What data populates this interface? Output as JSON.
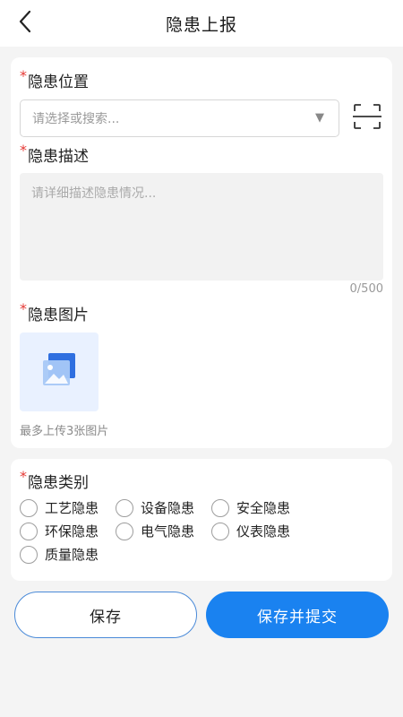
{
  "header": {
    "title": "隐患上报"
  },
  "form": {
    "required_mark": "*",
    "location": {
      "label": "隐患位置",
      "placeholder": "请选择或搜索..."
    },
    "description": {
      "label": "隐患描述",
      "placeholder": "请详细描述隐患情况...",
      "counter": "0/500"
    },
    "images": {
      "label": "隐患图片",
      "tip": "最多上传3张图片"
    },
    "category": {
      "label": "隐患类别",
      "options": [
        "工艺隐患",
        "设备隐患",
        "安全隐患",
        "环保隐患",
        "电气隐患",
        "仪表隐患",
        "质量隐患"
      ]
    }
  },
  "actions": {
    "save_label": "保存",
    "submit_label": "保存并提交"
  },
  "colors": {
    "primary": "#1a82f0",
    "required": "#e53935",
    "upload_bg": "#e9f1ff"
  }
}
